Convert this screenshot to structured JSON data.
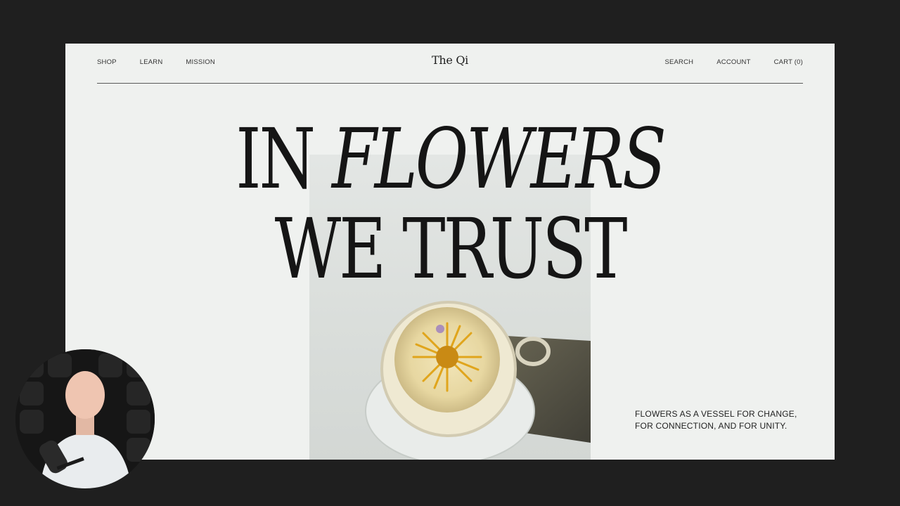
{
  "nav": {
    "left": [
      "SHOP",
      "LEARN",
      "MISSION"
    ],
    "logo": "The Qi",
    "right": [
      "SEARCH",
      "ACCOUNT",
      "CART (0)"
    ]
  },
  "hero": {
    "line1_plain": "IN",
    "line1_italic": "FLOWERS",
    "line2": "WE TRUST",
    "tagline_1": "FLOWERS AS A VESSEL FOR CHANGE,",
    "tagline_2": "FOR CONNECTION, AND FOR UNITY."
  },
  "colors": {
    "page_bg": "#eff1ef",
    "frame_bg": "#1f1f1f",
    "text": "#151515"
  },
  "icons": {
    "hero_image": "tea-cup-with-flower-image",
    "webcam": "presenter-webcam-avatar"
  }
}
